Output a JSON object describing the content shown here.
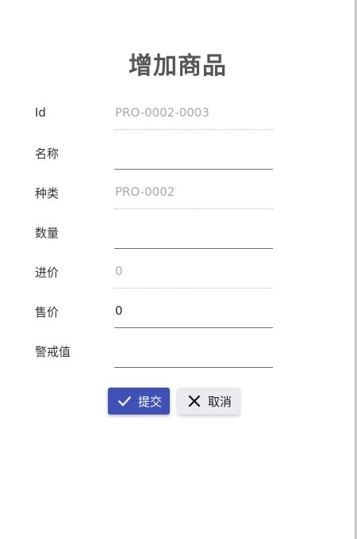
{
  "form": {
    "title": "增加商品",
    "fields": [
      {
        "label": "Id",
        "value": "PRO-0002-0003",
        "disabled": true
      },
      {
        "label": "名称",
        "value": "",
        "disabled": false
      },
      {
        "label": "种类",
        "value": "PRO-0002",
        "disabled": true
      },
      {
        "label": "数量",
        "value": "",
        "disabled": false
      },
      {
        "label": "进价",
        "value": "0",
        "disabled": true
      },
      {
        "label": "售价",
        "value": "0",
        "disabled": false
      },
      {
        "label": "警戒值",
        "value": "",
        "disabled": false
      }
    ]
  },
  "actions": {
    "submit_label": "提交",
    "submit_icon": "check-icon",
    "cancel_label": "取消",
    "cancel_icon": "close-icon"
  },
  "colors": {
    "primary": "#3f51b5",
    "title": "#555555",
    "cancel_bg": "#ebebef"
  }
}
